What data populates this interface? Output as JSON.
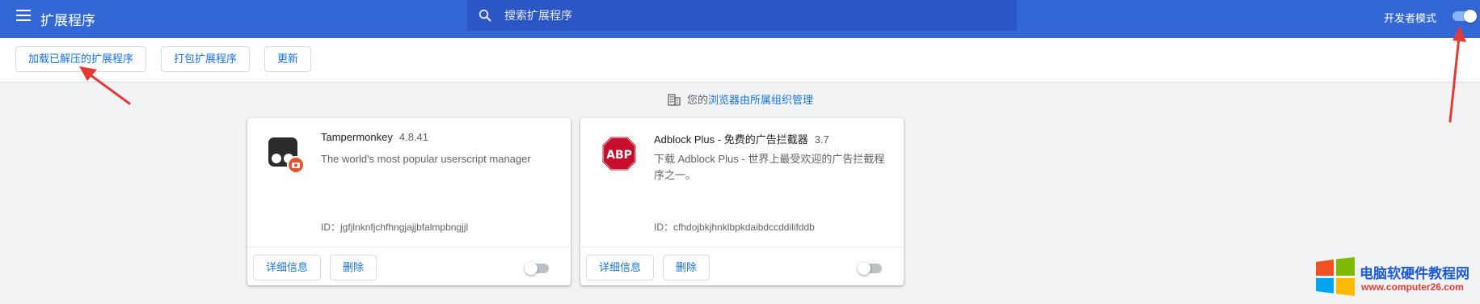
{
  "header": {
    "title": "扩展程序",
    "search_placeholder": "搜索扩展程序",
    "dev_mode_label": "开发者模式",
    "dev_mode_on": true
  },
  "toolbar": {
    "load_unpacked": "加载已解压的扩展程序",
    "pack": "打包扩展程序",
    "update": "更新"
  },
  "managed_notice": {
    "prefix": "您的",
    "link": "浏览器由所属组织管理"
  },
  "extensions": [
    {
      "name": "Tampermonkey",
      "version": "4.8.41",
      "description": "The world's most popular userscript manager",
      "id_label": "ID：",
      "id": "jgfjlnknfjchfhngjajjbfalmpbngjjl",
      "details_label": "详细信息",
      "remove_label": "删除",
      "enabled": false
    },
    {
      "name": "Adblock Plus - 免费的广告拦截器",
      "version": "3.7",
      "description": "下载 Adblock Plus - 世界上最受欢迎的广告拦截程序之一。",
      "id_label": "ID：",
      "id": "cfhdojbkjhnklbpkdaibdccddilifddb",
      "details_label": "详细信息",
      "remove_label": "删除",
      "enabled": false
    }
  ],
  "icons": {
    "menu": "hamburger-menu-icon",
    "search": "search-icon",
    "managed": "building-icon",
    "tampermonkey": "tampermonkey-icon",
    "abp": "abp-stop-sign-icon"
  },
  "colors": {
    "header": "#3367d6",
    "search_bg": "#2a56c6",
    "accent": "#1a73e8",
    "arrow": "#e53935"
  },
  "watermark": {
    "logo_text": "电脑软硬件教程网",
    "url": "www.computer26.com"
  }
}
